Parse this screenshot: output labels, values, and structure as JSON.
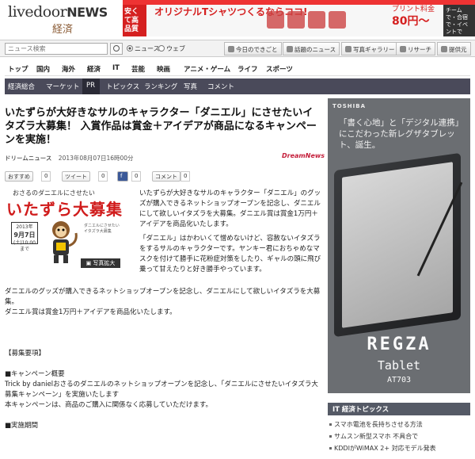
{
  "header": {
    "logo_main": "livedoor",
    "logo_news": "NEWS",
    "logo_sub": "経済",
    "banner": {
      "left_label": "安くて高品質",
      "headline": "オリジナルTシャツつくるならココ!",
      "price_label": "プリント料金",
      "price": "80円〜",
      "right_label": "チームで・合宿で・イベントで"
    }
  },
  "search": {
    "placeholder": "ニュース検索",
    "radio_news": "ニュース",
    "radio_web": "ウェブ",
    "tools": [
      "今日のできごと",
      "話題のニュース",
      "写真ギャラリー",
      "リサーチ",
      "提供元"
    ]
  },
  "nav": {
    "main": [
      "トップ",
      "国内",
      "海外",
      "経済",
      "IT",
      "芸能",
      "映画",
      "アニメ・ゲーム",
      "ライフ",
      "スポーツ"
    ],
    "sub": [
      "経済総合",
      "マーケット",
      "PR",
      "トピックス",
      "ランキング",
      "写真",
      "コメント"
    ],
    "sub_active": "PR"
  },
  "article": {
    "title": "いたずらが大好きなサルのキャラクター「ダニエル」にさせたいイタズラ大募集！ 入賞作品は賞金＋アイデアが商品になるキャンペーンを実施！",
    "source": "ドリームニュース",
    "date": "2013年08月07日16時00分",
    "source_logo": "DreamNews",
    "social": {
      "osusume": "おすすめ",
      "osusume_count": "0",
      "tweet": "ツイート",
      "tweet_count": "0",
      "fb_count": "0",
      "comment": "コメント",
      "comment_count": "0"
    },
    "promo": {
      "top": "おさるのダニエルにさせたい",
      "big": "いたずら大募集",
      "date_year": "2013年",
      "date_range": "9月7日",
      "date_note": "(土)10:00まで",
      "photo_btn": "写真拡大"
    },
    "lead": [
      "いたずらが大好きなサルのキャラクター「ダニエル」のグッズが購入できるネットショップオープンを記念し、ダニエルにして欲しいイタズラを大募集。ダニエル賞は賞金1万円＋アイデアを商品化いたします。",
      "「ダニエル」はかわいくて憎めないけど、容赦ないイタズラをするサルのキャラクターです。ヤンキー君におちゃめなマスクを付けて勝手に花粉症対策をしたり、ギャルの頭に飛び乗って甘えたりと好き勝手やっています。"
    ],
    "body": [
      "ダニエルのグッズが購入できるネットショップオープンを記念し、ダニエルにして欲しいイタズラを大募集。",
      "ダニエル賞は賞金1万円＋アイデアを商品化いたします。",
      "【募集要項】",
      "■キャンペーン概要",
      "Trick by danielおさるのダニエルのネットショップオープンを記念し、「ダニエルにさせたいイタズラ大募集キャンペーン」を実施いたします",
      "本キャンペーンは、商品のご購入に関係なく応募していただけます。",
      "■実施期間"
    ]
  },
  "ad": {
    "brand": "TOSHIBA",
    "copy": "「書く心地」と「デジタル連携」にこだわった新レグザタブレット、誕生。",
    "product": "REGZA",
    "product_line": "Tablet",
    "model": "AT703"
  },
  "topics": {
    "heading": "IT 経済トピックス",
    "items": [
      "スマホ電池を長持ちさせる方法",
      "サムスン新型スマホ 不具合で",
      "KDDIがWiMAX 2+ 対応モデル発表"
    ]
  }
}
